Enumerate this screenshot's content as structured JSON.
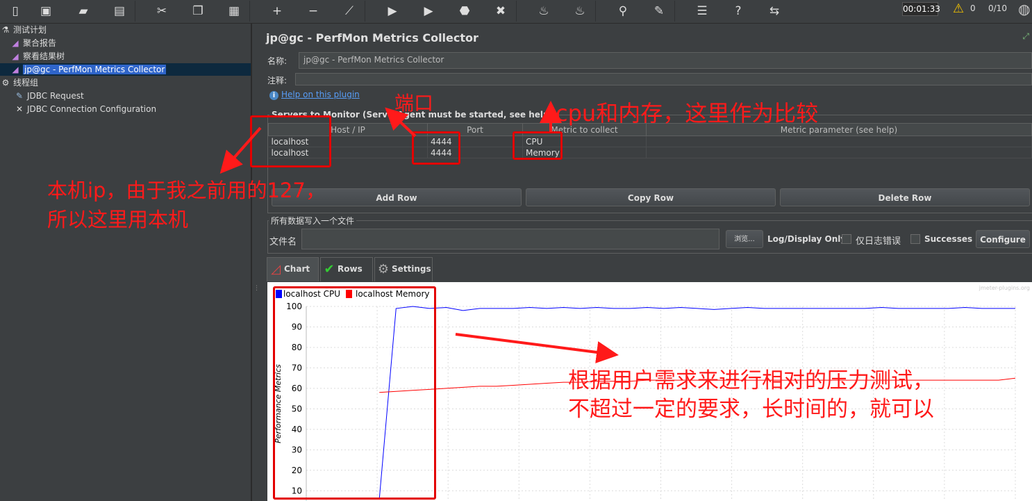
{
  "toolbar": {
    "buttons": [
      "new-icon",
      "templates-icon",
      "open-icon",
      "save-icon",
      "cut-icon",
      "copy-icon",
      "paste-icon",
      "expand-icon",
      "collapse-icon",
      "toggle-icon",
      "start-icon",
      "start-no-pause-icon",
      "stop-icon",
      "shutdown-icon",
      "clear-icon",
      "clear-all-icon",
      "search-icon",
      "reset-search-icon",
      "function-helper-icon",
      "help-icon",
      "remote-icon"
    ],
    "timer": "00:01:33",
    "warnings": "0",
    "threads": "0/10"
  },
  "tree": {
    "items": [
      {
        "label": "测试计划",
        "icon": "test-plan-icon"
      },
      {
        "label": "聚合报告",
        "icon": "listener-icon"
      },
      {
        "label": "察看结果树",
        "icon": "listener-icon"
      },
      {
        "label": "jp@gc - PerfMon Metrics Collector",
        "icon": "listener-icon"
      },
      {
        "label": "线程组",
        "icon": "thread-group-icon"
      },
      {
        "label": "JDBC Request",
        "icon": "sampler-icon"
      },
      {
        "label": "JDBC Connection Configuration",
        "icon": "config-icon"
      }
    ]
  },
  "panel": {
    "title": "jp@gc - PerfMon Metrics Collector",
    "name_label": "名称:",
    "name_value": "jp@gc - PerfMon Metrics Collector",
    "comment_label": "注释:",
    "help_link": "Help on this plugin",
    "servers_title": "Servers to Monitor (ServerAgent must be started, see help)",
    "columns": [
      "Host / IP",
      "Port",
      "Metric to collect",
      "Metric parameter (see help)"
    ],
    "rows": [
      {
        "host": "localhost",
        "port": "4444",
        "metric": "CPU",
        "param": ""
      },
      {
        "host": "localhost",
        "port": "4444",
        "metric": "Memory",
        "param": ""
      }
    ],
    "add_row": "Add Row",
    "copy_row": "Copy Row",
    "delete_row": "Delete Row",
    "file_group": "所有数据写入一个文件",
    "file_label": "文件名",
    "browse": "浏览...",
    "log_only": "Log/Display Only:",
    "errors_only": "仅日志错误",
    "successes": "Successes",
    "configure": "Configure"
  },
  "tabs": [
    {
      "label": "Chart",
      "icon": "chart-icon",
      "active": true
    },
    {
      "label": "Rows",
      "icon": "checkmark-icon",
      "active": false
    },
    {
      "label": "Settings",
      "icon": "gear-icon",
      "active": false
    }
  ],
  "chart_data": {
    "type": "line",
    "watermark": "jmeter-plugins.org",
    "ylabel": "Performance Metrics",
    "ylim": [
      5,
      100
    ],
    "yticks": [
      10,
      20,
      30,
      40,
      50,
      60,
      70,
      80,
      90,
      100
    ],
    "series": [
      {
        "name": "localhost CPU",
        "color": "#0000ff",
        "values": [
          6,
          6,
          6,
          99,
          100,
          99,
          99.5,
          98,
          99,
          99,
          99,
          99.5,
          99,
          99.5,
          99,
          99.5,
          99,
          99,
          99.5,
          99,
          99.5,
          99,
          98.5,
          99,
          99.5,
          99,
          99,
          99,
          99,
          99,
          99,
          99,
          99.5,
          99,
          99,
          99,
          99,
          99.5,
          99,
          99,
          99
        ]
      },
      {
        "name": "localhost Memory",
        "color": "#ff0000",
        "values": [
          null,
          null,
          58,
          58.5,
          59,
          59.5,
          60,
          60.5,
          61,
          61,
          61.5,
          62,
          62.5,
          63,
          63,
          63.5,
          63.5,
          63.5,
          64,
          64,
          64,
          64,
          64,
          64,
          64,
          64,
          64,
          64,
          64,
          64,
          64,
          64,
          64,
          64,
          64,
          64,
          64,
          64,
          64,
          64,
          65
        ]
      }
    ]
  },
  "annotations": {
    "port": "端口",
    "cpu_mem": "cpu和内存，这里作为比较",
    "host_line1": "本机ip，由于我之前用的127，",
    "host_line2": "所以这里用本机",
    "test_line1": "根据用户需求来进行相对的压力测试，",
    "test_line2": "不超过一定的要求，长时间的，就可以",
    "color": "#ff1a1a"
  }
}
